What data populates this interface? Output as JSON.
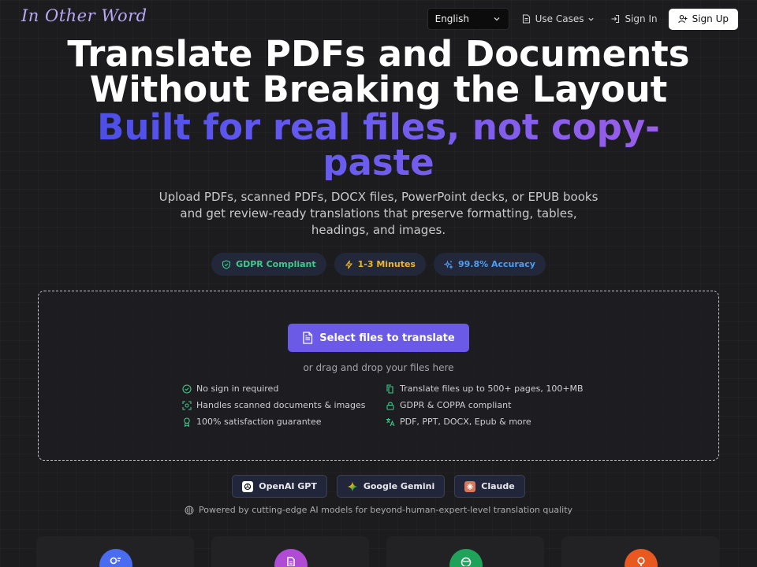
{
  "header": {
    "logo": "In Other Word",
    "language": "English",
    "use_cases": "Use Cases",
    "sign_in": "Sign In",
    "sign_up": "Sign Up"
  },
  "hero": {
    "title_line1": "Translate PDFs and Documents",
    "title_line2": "Without Breaking the Layout",
    "subtitle_line1": "Built for real files, not copy-",
    "subtitle_line2": "paste",
    "description": "Upload PDFs, scanned PDFs, DOCX files, PowerPoint decks, or EPUB books and get review-ready translations that preserve formatting, tables, headings, and images."
  },
  "badges": [
    {
      "label": "GDPR Compliant",
      "icon": "shield-check-icon",
      "color": "#3fc98a"
    },
    {
      "label": "1-3 Minutes",
      "icon": "lightning-icon",
      "color": "#f0b429"
    },
    {
      "label": "99.8% Accuracy",
      "icon": "sparkles-icon",
      "color": "#4c9df5"
    }
  ],
  "upload": {
    "button": "Select files to translate",
    "drag_text": "or drag and drop your files here",
    "features": [
      {
        "label": "No sign in required",
        "icon": "check-circle-icon"
      },
      {
        "label": "Translate files up to 500+ pages, 100+MB",
        "icon": "files-icon"
      },
      {
        "label": "Handles scanned documents & images",
        "icon": "scan-icon"
      },
      {
        "label": "GDPR & COPPA compliant",
        "icon": "lock-icon"
      },
      {
        "label": "100% satisfaction guarantee",
        "icon": "award-icon"
      },
      {
        "label": "PDF, PPT, DOCX, Epub & more",
        "icon": "translate-icon"
      }
    ]
  },
  "models": [
    {
      "label": "OpenAI GPT",
      "icon": "openai-icon"
    },
    {
      "label": "Google Gemini",
      "icon": "gemini-icon"
    },
    {
      "label": "Claude",
      "icon": "claude-icon"
    }
  ],
  "powered_by": "Powered by cutting-edge AI models for beyond-human-expert-level translation quality",
  "colors": {
    "accent": "#6a5ae6",
    "background": "#1c1c1e",
    "gradient_start": "#4b4ee8",
    "gradient_end": "#9b5fe8"
  }
}
